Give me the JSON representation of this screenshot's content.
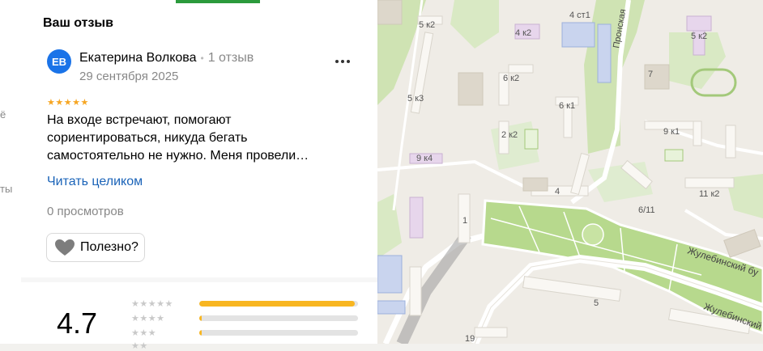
{
  "left_strip": {
    "fragment_1": "ё",
    "fragment_2": "ты"
  },
  "panel": {
    "section_title": "Ваш отзыв",
    "review": {
      "avatar_initials": "ЕВ",
      "author_name": "Екатерина Волкова",
      "author_reviews": "1 отзыв",
      "date": "29 сентября 2025",
      "stars": "★★★★★",
      "rating": 5,
      "text": "На входе встречают, помогают сориентироваться, никуда бегать самостоятельно не нужно. Меня провели…",
      "read_more": "Читать целиком",
      "views": "0 просмотров",
      "helpful_label": "Полезно?"
    },
    "rating_summary": {
      "value": "4.7",
      "rows": [
        {
          "stars": "★★★★★",
          "fraction": 0.98
        },
        {
          "stars": "★★★★",
          "fraction": 0.01
        },
        {
          "stars": "★★★",
          "fraction": 0.01
        },
        {
          "stars": "★★",
          "fraction": 0
        }
      ]
    }
  },
  "map": {
    "labels": {
      "b1": "5 к2",
      "b2": "4 ст1",
      "b3": "4 к2",
      "b4": "5 к2",
      "b5": "7",
      "b6": "5 к3",
      "b7": "6 к2",
      "b8": "6 к1",
      "b9": "9 к1",
      "b10": "2 к2",
      "b11": "9 к4",
      "b12": "4",
      "b13": "6/11",
      "b14": "11 к2",
      "b15": "1",
      "b16": "5",
      "b17": "19"
    },
    "street_1": "Пронская",
    "street_2": "Жулебинский бу",
    "street_3": "Жулебинский"
  }
}
